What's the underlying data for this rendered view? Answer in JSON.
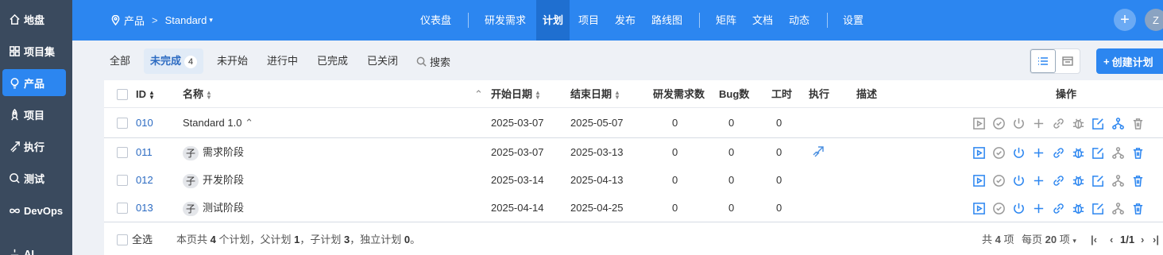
{
  "sidebar": {
    "items": [
      {
        "label": "地盘",
        "icon": "home-icon"
      },
      {
        "label": "项目集",
        "icon": "grid-icon"
      },
      {
        "label": "产品",
        "icon": "bulb-icon"
      },
      {
        "label": "项目",
        "icon": "rocket-icon"
      },
      {
        "label": "执行",
        "icon": "run-icon"
      },
      {
        "label": "测试",
        "icon": "search-icon"
      },
      {
        "label": "DevOps",
        "icon": "infinity-icon"
      },
      {
        "label": "AI",
        "icon": "ai-icon"
      }
    ]
  },
  "header": {
    "breadcrumb_product": "产品",
    "breadcrumb_sep": ">",
    "breadcrumb_current": "Standard",
    "nav": [
      "仪表盘",
      "研发需求",
      "计划",
      "项目",
      "发布",
      "路线图",
      "矩阵",
      "文档",
      "动态",
      "设置"
    ],
    "avatar": "Z",
    "plus": "+"
  },
  "filter": {
    "tabs": [
      "全部",
      "未完成",
      "未开始",
      "进行中",
      "已完成",
      "已关闭"
    ],
    "active_count": "4",
    "search": "搜索",
    "create": "创建计划"
  },
  "table": {
    "columns": [
      "ID",
      "名称",
      "开始日期",
      "结束日期",
      "研发需求数",
      "Bug数",
      "工时",
      "执行",
      "描述",
      "操作"
    ],
    "rows": [
      {
        "id": "010",
        "name": "Standard 1.0",
        "start": "2025-03-07",
        "end": "2025-05-07",
        "stories": "0",
        "bugs": "0",
        "hours": "0",
        "child": false
      },
      {
        "id": "011",
        "tag": "子",
        "name": "需求阶段",
        "start": "2025-03-07",
        "end": "2025-03-13",
        "stories": "0",
        "bugs": "0",
        "hours": "0",
        "child": true
      },
      {
        "id": "012",
        "tag": "子",
        "name": "开发阶段",
        "start": "2025-03-14",
        "end": "2025-04-13",
        "stories": "0",
        "bugs": "0",
        "hours": "0",
        "child": true
      },
      {
        "id": "013",
        "tag": "子",
        "name": "测试阶段",
        "start": "2025-04-14",
        "end": "2025-04-25",
        "stories": "0",
        "bugs": "0",
        "hours": "0",
        "child": true
      }
    ]
  },
  "footer": {
    "select_all": "全选",
    "summary_prefix": "本页共",
    "summary_total": "4",
    "summary_mid1": "个计划，父计划",
    "summary_parent": "1",
    "summary_mid2": "，子计划",
    "summary_child": "3",
    "summary_mid3": "，独立计划",
    "summary_indep": "0",
    "summary_end": "。",
    "total_prefix": "共",
    "total": "4",
    "total_suffix": "项",
    "per_page_prefix": "每页",
    "per_page": "20",
    "per_page_suffix": "项",
    "page": "1/1"
  }
}
